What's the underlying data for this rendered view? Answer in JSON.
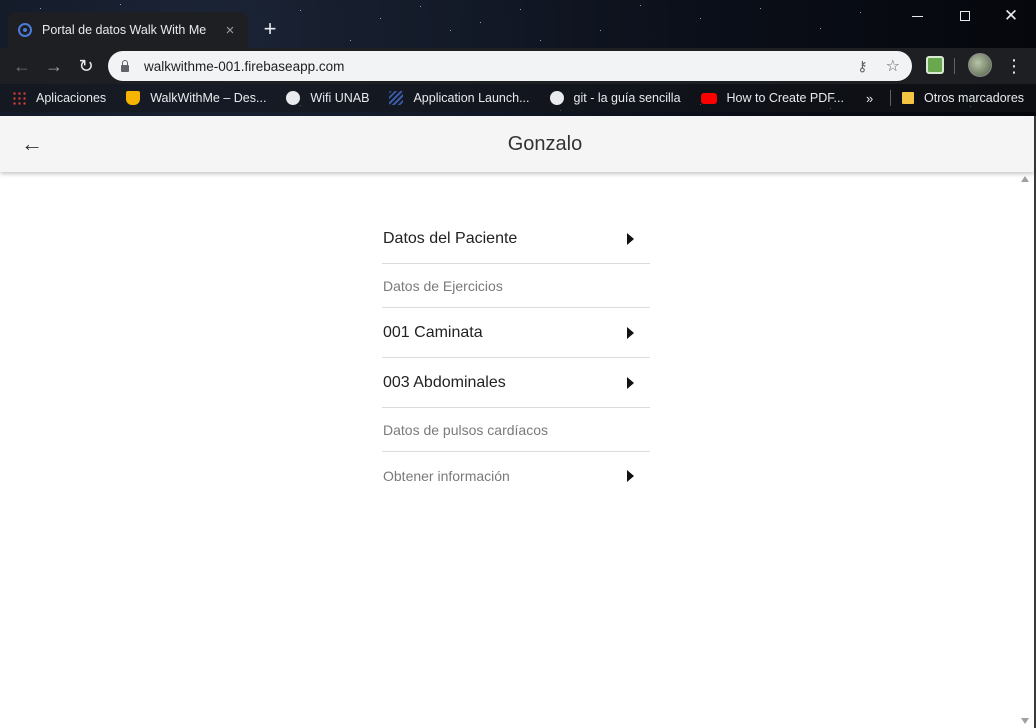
{
  "browser": {
    "tab_title": "Portal de datos Walk With Me",
    "tab_close": "×",
    "new_tab": "+",
    "url": "walkwithme-001.firebaseapp.com",
    "bookmarks": [
      {
        "label": "Aplicaciones",
        "icon": "apps-grid-icon"
      },
      {
        "label": "WalkWithMe – Des...",
        "icon": "firebase-icon"
      },
      {
        "label": "Wifi UNAB",
        "icon": "globe-icon"
      },
      {
        "label": "Application Launch...",
        "icon": "stack-icon"
      },
      {
        "label": "git - la guía sencilla",
        "icon": "globe-icon"
      },
      {
        "label": "How to Create PDF...",
        "icon": "youtube-icon"
      }
    ],
    "bookmarks_more": "»",
    "other_bookmarks": "Otros marcadores"
  },
  "appbar": {
    "back_glyph": "←",
    "title": "Gonzalo"
  },
  "menu": {
    "items": [
      {
        "label": "Datos del Paciente",
        "kind": "main",
        "has_arrow": true
      },
      {
        "label": "Datos de Ejercicios",
        "kind": "sub",
        "has_arrow": false
      },
      {
        "label": "001 Caminata",
        "kind": "main",
        "has_arrow": true
      },
      {
        "label": "003 Abdominales",
        "kind": "main",
        "has_arrow": true
      },
      {
        "label": "Datos de pulsos cardíacos",
        "kind": "sub",
        "has_arrow": false
      },
      {
        "label": "Obtener información",
        "kind": "sub",
        "has_arrow": true
      }
    ]
  },
  "colors": {
    "appbar_bg": "#f5f5f5",
    "divider": "#dcdcdc",
    "subheader_text": "#7a7a7a"
  }
}
